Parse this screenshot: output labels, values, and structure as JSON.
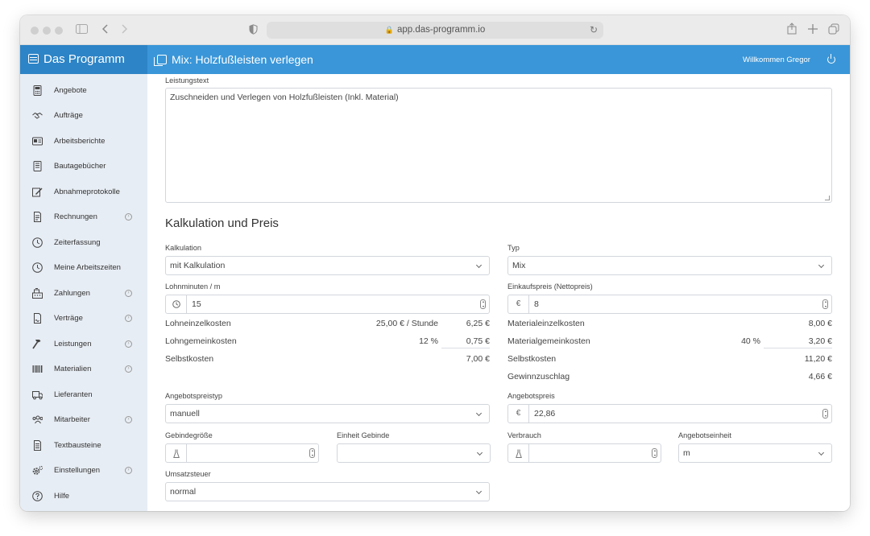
{
  "browser": {
    "url": "app.das-programm.io"
  },
  "header": {
    "brand": "Das Programm",
    "page_title": "Mix: Holzfußleisten verlegen",
    "welcome": "Willkommen Gregor"
  },
  "sidebar": {
    "items": [
      {
        "label": "Angebote",
        "icon": "calculator-icon",
        "has_submenu": false
      },
      {
        "label": "Aufträge",
        "icon": "handshake-icon",
        "has_submenu": false
      },
      {
        "label": "Arbeitsberichte",
        "icon": "id-card-icon",
        "has_submenu": false
      },
      {
        "label": "Bautagebücher",
        "icon": "book-icon",
        "has_submenu": false
      },
      {
        "label": "Abnahmeprotokolle",
        "icon": "signature-icon",
        "has_submenu": false
      },
      {
        "label": "Rechnungen",
        "icon": "invoice-icon",
        "has_submenu": true
      },
      {
        "label": "Zeiterfassung",
        "icon": "clock-icon",
        "has_submenu": false
      },
      {
        "label": "Meine Arbeitszeiten",
        "icon": "clock-icon",
        "has_submenu": false
      },
      {
        "label": "Zahlungen",
        "icon": "cash-register-icon",
        "has_submenu": true
      },
      {
        "label": "Verträge",
        "icon": "contract-icon",
        "has_submenu": true
      },
      {
        "label": "Leistungen",
        "icon": "hammer-icon",
        "has_submenu": true
      },
      {
        "label": "Materialien",
        "icon": "barcode-icon",
        "has_submenu": true
      },
      {
        "label": "Lieferanten",
        "icon": "truck-icon",
        "has_submenu": false
      },
      {
        "label": "Mitarbeiter",
        "icon": "users-icon",
        "has_submenu": true
      },
      {
        "label": "Textbausteine",
        "icon": "text-file-icon",
        "has_submenu": false
      },
      {
        "label": "Einstellungen",
        "icon": "gears-icon",
        "has_submenu": true
      },
      {
        "label": "Hilfe",
        "icon": "question-icon",
        "has_submenu": false
      }
    ]
  },
  "form": {
    "leistungstext_label": "Leistungstext",
    "leistungstext_value": "Zuschneiden und Verlegen von Holzfußleisten (Inkl. Material)",
    "section_title": "Kalkulation und Preis",
    "kalkulation_label": "Kalkulation",
    "kalkulation_value": "mit Kalkulation",
    "typ_label": "Typ",
    "typ_value": "Mix",
    "lohnminuten_label": "Lohnminuten / m",
    "lohnminuten_value": "15",
    "einkaufspreis_label": "Einkaufspreis (Nettopreis)",
    "einkaufspreis_value": "8",
    "currency_symbol": "€",
    "angebotspreistyp_label": "Angebotspreistyp",
    "angebotspreistyp_value": "manuell",
    "angebotspreis_label": "Angebotspreis",
    "angebotspreis_value": "22,86",
    "gebindegroesse_label": "Gebindegröße",
    "einheit_gebinde_label": "Einheit Gebinde",
    "verbrauch_label": "Verbrauch",
    "angebotseinheit_label": "Angebotseinheit",
    "angebotseinheit_value": "m",
    "umsatzsteuer_label": "Umsatzsteuer",
    "umsatzsteuer_value": "normal"
  },
  "calc_left": {
    "lohneinzelkosten_label": "Lohneinzelkosten",
    "lohneinzelkosten_rate": "25,00 € / Stunde",
    "lohneinzelkosten_value": "6,25 €",
    "lohngemeinkosten_label": "Lohngemeinkosten",
    "lohngemeinkosten_pct": "12 %",
    "lohngemeinkosten_value": "0,75 €",
    "selbstkosten_label": "Selbstkosten",
    "selbstkosten_value": "7,00 €"
  },
  "calc_right": {
    "materialeinzelkosten_label": "Materialeinzelkosten",
    "materialeinzelkosten_value": "8,00 €",
    "materialgemeinkosten_label": "Materialgemeinkosten",
    "materialgemeinkosten_pct": "40 %",
    "materialgemeinkosten_value": "3,20 €",
    "selbstkosten_label": "Selbstkosten",
    "selbstkosten_value": "11,20 €",
    "gewinnzuschlag_label": "Gewinnzuschlag",
    "gewinnzuschlag_value": "4,66 €"
  },
  "colors": {
    "header": "#3a96d8",
    "brand": "#2d84c6",
    "sidebar": "#e7edf4"
  }
}
